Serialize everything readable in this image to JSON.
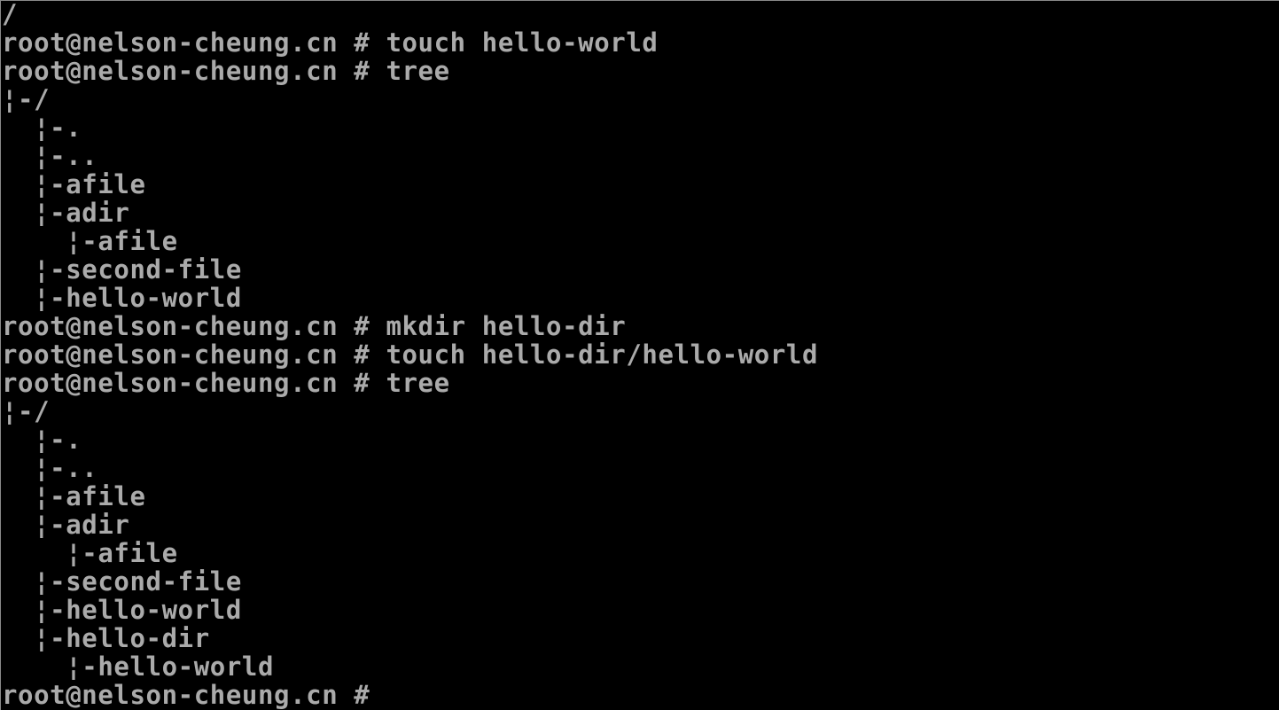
{
  "terminal": {
    "background": "#000000",
    "foreground": "#aaaaaa",
    "prompt": "root@nelson-cheung.cn # ",
    "lines": [
      {
        "kind": "output",
        "text": "/"
      },
      {
        "kind": "command",
        "text": "touch hello-world"
      },
      {
        "kind": "command",
        "text": "tree"
      },
      {
        "kind": "output",
        "text": "¦-/"
      },
      {
        "kind": "output",
        "text": "  ¦-."
      },
      {
        "kind": "output",
        "text": "  ¦-.."
      },
      {
        "kind": "output",
        "text": "  ¦-afile"
      },
      {
        "kind": "output",
        "text": "  ¦-adir"
      },
      {
        "kind": "output",
        "text": "    ¦-afile"
      },
      {
        "kind": "output",
        "text": "  ¦-second-file"
      },
      {
        "kind": "output",
        "text": "  ¦-hello-world"
      },
      {
        "kind": "command",
        "text": "mkdir hello-dir"
      },
      {
        "kind": "command",
        "text": "touch hello-dir/hello-world"
      },
      {
        "kind": "command",
        "text": "tree"
      },
      {
        "kind": "output",
        "text": "¦-/"
      },
      {
        "kind": "output",
        "text": "  ¦-."
      },
      {
        "kind": "output",
        "text": "  ¦-.."
      },
      {
        "kind": "output",
        "text": "  ¦-afile"
      },
      {
        "kind": "output",
        "text": "  ¦-adir"
      },
      {
        "kind": "output",
        "text": "    ¦-afile"
      },
      {
        "kind": "output",
        "text": "  ¦-second-file"
      },
      {
        "kind": "output",
        "text": "  ¦-hello-world"
      },
      {
        "kind": "output",
        "text": "  ¦-hello-dir"
      },
      {
        "kind": "output",
        "text": "    ¦-hello-world"
      },
      {
        "kind": "command",
        "text": ""
      }
    ]
  }
}
